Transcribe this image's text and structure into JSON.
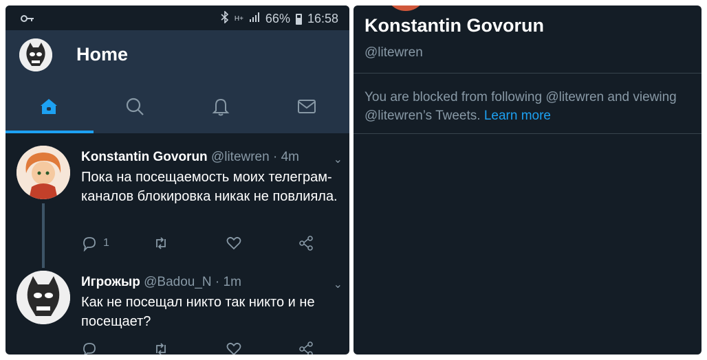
{
  "status_bar": {
    "key_icon": "key-icon",
    "bluetooth_icon": "bluetooth-icon",
    "network": "H+",
    "battery": "66%",
    "time": "16:58"
  },
  "header": {
    "title": "Home"
  },
  "tabs": [
    {
      "name": "home",
      "icon": "home-icon",
      "active": true
    },
    {
      "name": "search",
      "icon": "search-icon",
      "active": false
    },
    {
      "name": "notifications",
      "icon": "bell-icon",
      "active": false
    },
    {
      "name": "messages",
      "icon": "mail-icon",
      "active": false
    }
  ],
  "tweets": [
    {
      "name": "Konstantin Govorun",
      "meta": "@litewren · 4m",
      "text": "Пока на посещаемость моих телеграм-каналов блокировка никак не повлияла.",
      "reply_count": "1"
    },
    {
      "name": "Игрожыр",
      "meta": "@Badou_N · 1m",
      "text": "Как не посещал никто так никто и не посещает?",
      "reply_count": ""
    }
  ],
  "profile": {
    "name": "Konstantin Govorun",
    "handle": "@litewren",
    "blocked_text": "You are blocked from following @litewren and viewing @litewren’s Tweets.",
    "learn_more": "Learn more"
  },
  "colors": {
    "background": "#141d26",
    "header": "#243447",
    "accent": "#1da1f2",
    "muted": "#8899a6"
  }
}
